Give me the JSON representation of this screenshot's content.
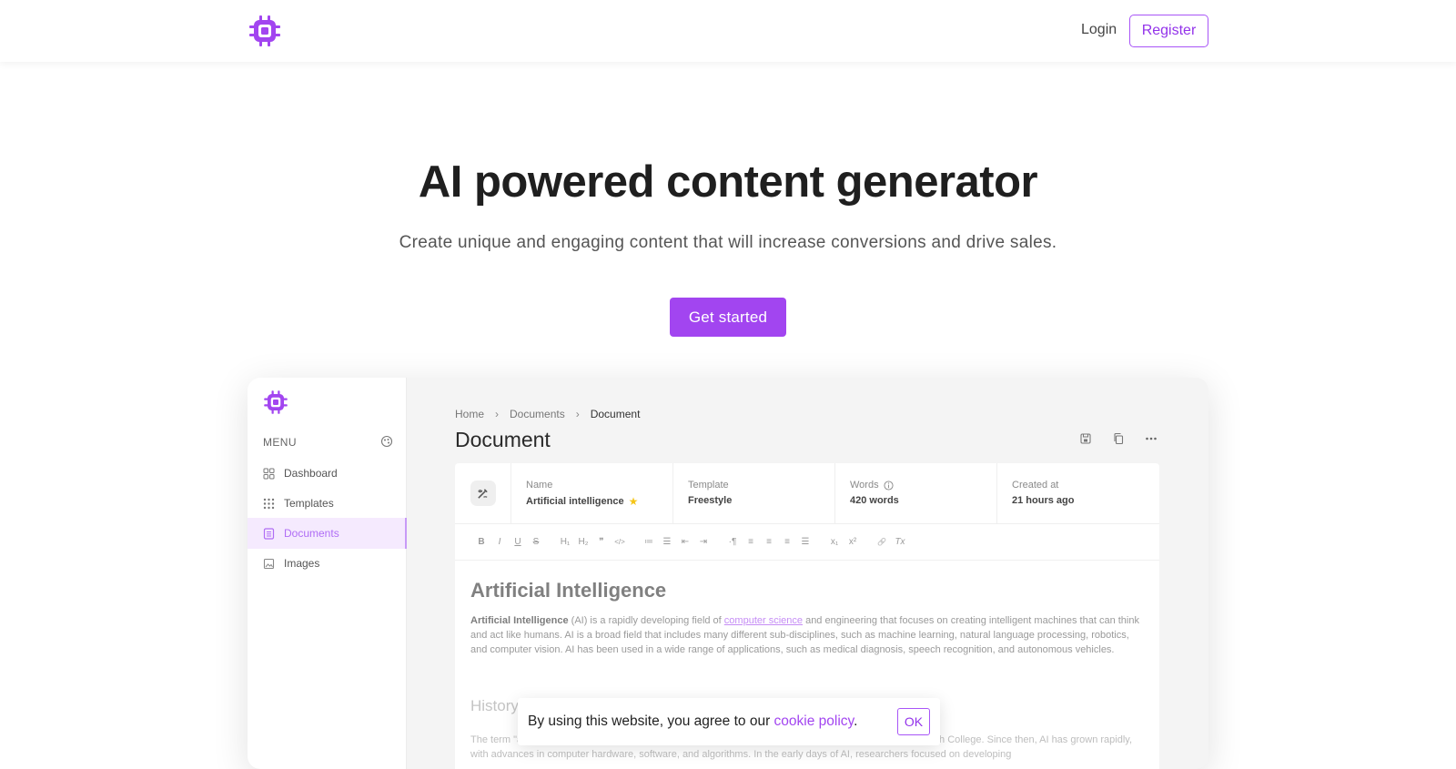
{
  "header": {
    "logo_icon": "cpu-chip-icon",
    "login_label": "Login",
    "register_label": "Register"
  },
  "hero": {
    "title": "AI powered content generator",
    "subtitle": "Create unique and engaging content that will increase conversions and drive sales.",
    "cta_label": "Get started"
  },
  "preview": {
    "sidebar": {
      "menu_label": "MENU",
      "menu_icon": "palette-icon",
      "items": [
        {
          "label": "Dashboard",
          "icon": "grid-icon",
          "active": false
        },
        {
          "label": "Templates",
          "icon": "dots-grid-icon",
          "active": false
        },
        {
          "label": "Documents",
          "icon": "document-icon",
          "active": true
        },
        {
          "label": "Images",
          "icon": "image-icon",
          "active": false
        }
      ]
    },
    "breadcrumb": [
      "Home",
      "Documents",
      "Document"
    ],
    "title": "Document",
    "actions": [
      "save-icon",
      "copy-icon",
      "more-icon"
    ],
    "meta": {
      "name_label": "Name",
      "name_value": "Artificial intelligence",
      "template_label": "Template",
      "template_value": "Freestyle",
      "words_label": "Words",
      "words_value": "420 words",
      "created_label": "Created at",
      "created_value": "21 hours ago"
    },
    "toolbar": {
      "bold": "B",
      "italic": "I",
      "underline": "U",
      "strike": "S",
      "h1": "H₁",
      "h2": "H₂",
      "quote": "❞",
      "code": "</>",
      "ol": "≔",
      "ul": "☰",
      "outdent": "⇤",
      "indent": "⇥",
      "dir": "·¶",
      "left": "≡",
      "center": "≡",
      "right": "≡",
      "justify": "☰",
      "sub": "x₁",
      "sup": "x²",
      "link": "🔗",
      "clear": "Tx"
    },
    "content": {
      "heading": "Artificial Intelligence",
      "p1_bold": "Artificial Intelligence",
      "p1_a": " (AI) is a rapidly developing field of ",
      "p1_link": "computer science",
      "p1_b": " and engineering that focuses on creating intelligent machines that can think and act like humans. AI is a broad field that includes many different sub-disciplines, such as machine learning, natural language processing, robotics, and computer vision. AI has been used in a wide range of applications, such as medical diagnosis, speech recognition, and autonomous vehicles.",
      "heading2": "History",
      "p2": "The term \"artificial intelligence\" was first used in 1956 by John McCarthy, a computer scientist at Dartmouth College. Since then, AI has grown rapidly, with advances in computer hardware, software, and algorithms. In the early days of AI, researchers focused on developing"
    }
  },
  "cookie": {
    "text": "By using this website, you agree to our ",
    "link": "cookie policy",
    "suffix": ".",
    "ok_label": "OK"
  },
  "colors": {
    "accent": "#a245f0",
    "accent_border": "#a855f7",
    "active_bg": "#f5eafe",
    "star": "#f5c518"
  }
}
